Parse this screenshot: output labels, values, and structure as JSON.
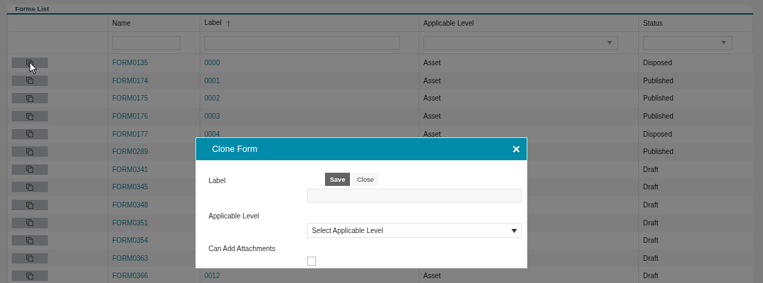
{
  "panel": {
    "title": "Forms List"
  },
  "table": {
    "columns": [
      {
        "label": "Name",
        "sorted": false,
        "kind": "text"
      },
      {
        "label": "Label",
        "sorted": true,
        "kind": "text"
      },
      {
        "label": "Applicable Level",
        "sorted": false,
        "kind": "select"
      },
      {
        "label": "Status",
        "sorted": false,
        "kind": "select"
      }
    ],
    "rows": [
      {
        "name": "FORM0135",
        "label": "0000",
        "level": "Asset",
        "status": "Disposed"
      },
      {
        "name": "FORM0174",
        "label": "0001",
        "level": "Asset",
        "status": "Published"
      },
      {
        "name": "FORM0175",
        "label": "0002",
        "level": "Asset",
        "status": "Published"
      },
      {
        "name": "FORM0176",
        "label": "0003",
        "level": "Asset",
        "status": "Published"
      },
      {
        "name": "FORM0177",
        "label": "0004",
        "level": "Asset",
        "status": "Disposed"
      },
      {
        "name": "FORM0289",
        "status": "Published"
      },
      {
        "name": "FORM0341",
        "status": "Draft"
      },
      {
        "name": "FORM0345",
        "status": "Draft"
      },
      {
        "name": "FORM0348",
        "status": "Draft"
      },
      {
        "name": "FORM0351",
        "status": "Draft"
      },
      {
        "name": "FORM0354",
        "status": "Draft"
      },
      {
        "name": "FORM0363",
        "status": "Draft"
      },
      {
        "name": "FORM0366",
        "label": "0012",
        "level": "Asset",
        "status": "Draft"
      }
    ]
  },
  "modal": {
    "title": "Clone Form",
    "buttons": [
      {
        "label": "Save",
        "primary": true
      },
      {
        "label": "Close",
        "primary": false
      }
    ],
    "fields": [
      {
        "kind": "text",
        "label": "Label"
      },
      {
        "kind": "select",
        "label": "Applicable Level",
        "placeholder": "Select Applicable Level"
      },
      {
        "kind": "checkbox",
        "label": "Can Add Attachments",
        "checked": false
      }
    ]
  }
}
